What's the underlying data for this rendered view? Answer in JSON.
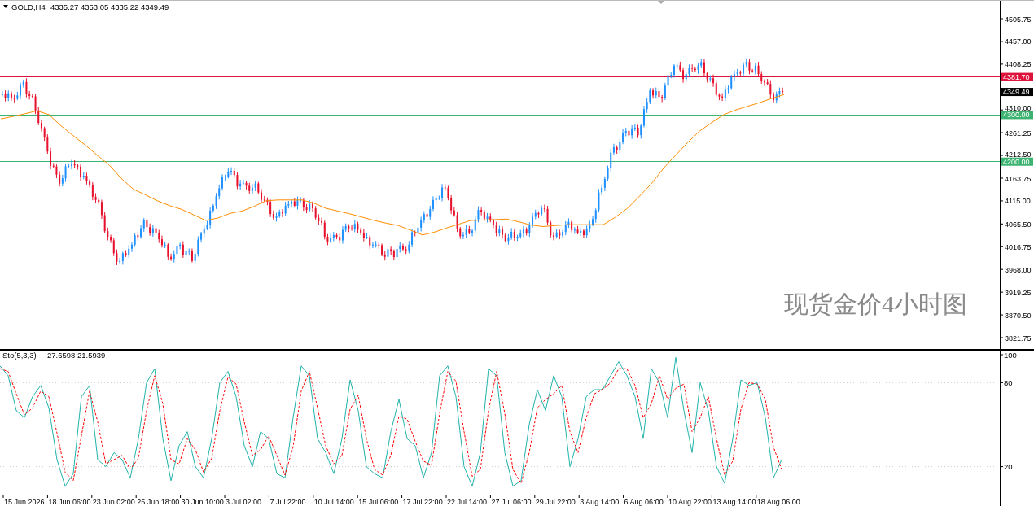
{
  "price_panel": {
    "symbol": "GOLD,H4",
    "ohlc": "4335.27 4353.05 4335.22 4349.49",
    "title": "现货金价4小时图",
    "axis_labels": [
      "4505.75",
      "4457.00",
      "4408.25",
      "4310.00",
      "4261.25",
      "4212.50",
      "4163.75",
      "4115.00",
      "4065.50",
      "4016.75",
      "3968.00",
      "3919.25",
      "3870.50",
      "3821.75"
    ],
    "levels": [
      {
        "kind": "line",
        "label": "4381.70",
        "color": "#dc143c"
      },
      {
        "kind": "tag",
        "label": "4349.49",
        "color": "#000000"
      },
      {
        "kind": "line",
        "label": "4300.00",
        "color": "#3cb371"
      },
      {
        "kind": "line",
        "label": "4200.00",
        "color": "#3cb371"
      }
    ]
  },
  "stochastic_panel": {
    "name": "Sto(5,3,3)",
    "readings": "27.6598 21.5939",
    "axis_labels": [
      "100",
      "80",
      "20"
    ]
  },
  "time_axis": {
    "labels": [
      "15 Jun 2026",
      "18 Jun 06:00",
      "23 Jun 02:00",
      "25 Jun 18:00",
      "30 Jun 10:00",
      "3 Jul 02:00",
      "7 Jul 22:00",
      "10 Jul 14:00",
      "15 Jul 06:00",
      "17 Jul 22:00",
      "22 Jul 14:00",
      "27 Jul 06:00",
      "29 Jul 22:00",
      "3 Aug 14:00",
      "6 Aug 06:00",
      "10 Aug 22:00",
      "13 Aug 14:00",
      "18 Aug 06:00"
    ]
  }
}
